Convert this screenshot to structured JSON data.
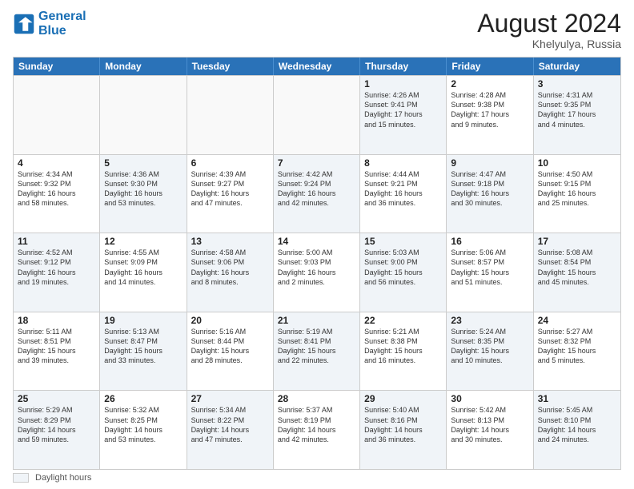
{
  "logo": {
    "line1": "General",
    "line2": "Blue"
  },
  "title": "August 2024",
  "location": "Khelyulya, Russia",
  "header_days": [
    "Sunday",
    "Monday",
    "Tuesday",
    "Wednesday",
    "Thursday",
    "Friday",
    "Saturday"
  ],
  "footer_label": "Daylight hours",
  "weeks": [
    [
      {
        "day": "",
        "text": "",
        "empty": true
      },
      {
        "day": "",
        "text": "",
        "empty": true
      },
      {
        "day": "",
        "text": "",
        "empty": true
      },
      {
        "day": "",
        "text": "",
        "empty": true
      },
      {
        "day": "1",
        "text": "Sunrise: 4:26 AM\nSunset: 9:41 PM\nDaylight: 17 hours\nand 15 minutes.",
        "shaded": true
      },
      {
        "day": "2",
        "text": "Sunrise: 4:28 AM\nSunset: 9:38 PM\nDaylight: 17 hours\nand 9 minutes.",
        "shaded": false
      },
      {
        "day": "3",
        "text": "Sunrise: 4:31 AM\nSunset: 9:35 PM\nDaylight: 17 hours\nand 4 minutes.",
        "shaded": true
      }
    ],
    [
      {
        "day": "4",
        "text": "Sunrise: 4:34 AM\nSunset: 9:32 PM\nDaylight: 16 hours\nand 58 minutes.",
        "shaded": false
      },
      {
        "day": "5",
        "text": "Sunrise: 4:36 AM\nSunset: 9:30 PM\nDaylight: 16 hours\nand 53 minutes.",
        "shaded": true
      },
      {
        "day": "6",
        "text": "Sunrise: 4:39 AM\nSunset: 9:27 PM\nDaylight: 16 hours\nand 47 minutes.",
        "shaded": false
      },
      {
        "day": "7",
        "text": "Sunrise: 4:42 AM\nSunset: 9:24 PM\nDaylight: 16 hours\nand 42 minutes.",
        "shaded": true
      },
      {
        "day": "8",
        "text": "Sunrise: 4:44 AM\nSunset: 9:21 PM\nDaylight: 16 hours\nand 36 minutes.",
        "shaded": false
      },
      {
        "day": "9",
        "text": "Sunrise: 4:47 AM\nSunset: 9:18 PM\nDaylight: 16 hours\nand 30 minutes.",
        "shaded": true
      },
      {
        "day": "10",
        "text": "Sunrise: 4:50 AM\nSunset: 9:15 PM\nDaylight: 16 hours\nand 25 minutes.",
        "shaded": false
      }
    ],
    [
      {
        "day": "11",
        "text": "Sunrise: 4:52 AM\nSunset: 9:12 PM\nDaylight: 16 hours\nand 19 minutes.",
        "shaded": true
      },
      {
        "day": "12",
        "text": "Sunrise: 4:55 AM\nSunset: 9:09 PM\nDaylight: 16 hours\nand 14 minutes.",
        "shaded": false
      },
      {
        "day": "13",
        "text": "Sunrise: 4:58 AM\nSunset: 9:06 PM\nDaylight: 16 hours\nand 8 minutes.",
        "shaded": true
      },
      {
        "day": "14",
        "text": "Sunrise: 5:00 AM\nSunset: 9:03 PM\nDaylight: 16 hours\nand 2 minutes.",
        "shaded": false
      },
      {
        "day": "15",
        "text": "Sunrise: 5:03 AM\nSunset: 9:00 PM\nDaylight: 15 hours\nand 56 minutes.",
        "shaded": true
      },
      {
        "day": "16",
        "text": "Sunrise: 5:06 AM\nSunset: 8:57 PM\nDaylight: 15 hours\nand 51 minutes.",
        "shaded": false
      },
      {
        "day": "17",
        "text": "Sunrise: 5:08 AM\nSunset: 8:54 PM\nDaylight: 15 hours\nand 45 minutes.",
        "shaded": true
      }
    ],
    [
      {
        "day": "18",
        "text": "Sunrise: 5:11 AM\nSunset: 8:51 PM\nDaylight: 15 hours\nand 39 minutes.",
        "shaded": false
      },
      {
        "day": "19",
        "text": "Sunrise: 5:13 AM\nSunset: 8:47 PM\nDaylight: 15 hours\nand 33 minutes.",
        "shaded": true
      },
      {
        "day": "20",
        "text": "Sunrise: 5:16 AM\nSunset: 8:44 PM\nDaylight: 15 hours\nand 28 minutes.",
        "shaded": false
      },
      {
        "day": "21",
        "text": "Sunrise: 5:19 AM\nSunset: 8:41 PM\nDaylight: 15 hours\nand 22 minutes.",
        "shaded": true
      },
      {
        "day": "22",
        "text": "Sunrise: 5:21 AM\nSunset: 8:38 PM\nDaylight: 15 hours\nand 16 minutes.",
        "shaded": false
      },
      {
        "day": "23",
        "text": "Sunrise: 5:24 AM\nSunset: 8:35 PM\nDaylight: 15 hours\nand 10 minutes.",
        "shaded": true
      },
      {
        "day": "24",
        "text": "Sunrise: 5:27 AM\nSunset: 8:32 PM\nDaylight: 15 hours\nand 5 minutes.",
        "shaded": false
      }
    ],
    [
      {
        "day": "25",
        "text": "Sunrise: 5:29 AM\nSunset: 8:29 PM\nDaylight: 14 hours\nand 59 minutes.",
        "shaded": true
      },
      {
        "day": "26",
        "text": "Sunrise: 5:32 AM\nSunset: 8:25 PM\nDaylight: 14 hours\nand 53 minutes.",
        "shaded": false
      },
      {
        "day": "27",
        "text": "Sunrise: 5:34 AM\nSunset: 8:22 PM\nDaylight: 14 hours\nand 47 minutes.",
        "shaded": true
      },
      {
        "day": "28",
        "text": "Sunrise: 5:37 AM\nSunset: 8:19 PM\nDaylight: 14 hours\nand 42 minutes.",
        "shaded": false
      },
      {
        "day": "29",
        "text": "Sunrise: 5:40 AM\nSunset: 8:16 PM\nDaylight: 14 hours\nand 36 minutes.",
        "shaded": true
      },
      {
        "day": "30",
        "text": "Sunrise: 5:42 AM\nSunset: 8:13 PM\nDaylight: 14 hours\nand 30 minutes.",
        "shaded": false
      },
      {
        "day": "31",
        "text": "Sunrise: 5:45 AM\nSunset: 8:10 PM\nDaylight: 14 hours\nand 24 minutes.",
        "shaded": true
      }
    ]
  ]
}
